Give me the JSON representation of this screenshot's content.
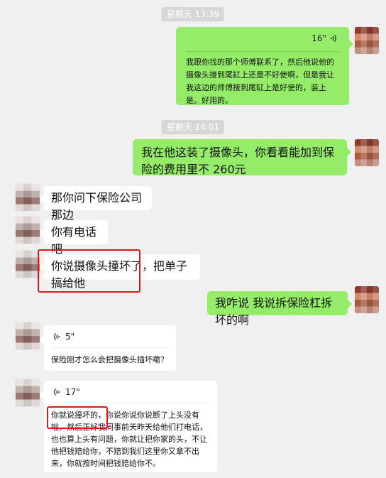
{
  "timestamps": {
    "first": "星期天 13:39",
    "second": "星期天 14:01"
  },
  "messages": {
    "m1": {
      "duration": "16\"",
      "text": "我跟你找的那个师傅联系了，然后他说他的摄像头接到尾缸上还是不好使啊，但是我让我这边的师傅接到尾缸上是好使的，装上是。好用的。"
    },
    "m2": {
      "text": "我在他这装了摄像头，你看看能加到保险的费用里不 260元"
    },
    "m3": {
      "text": "那你问下保险公司那边"
    },
    "m4": {
      "text": "你有电话吧"
    },
    "m5": {
      "text": "你说摄像头撞坏了，把单子搞给他"
    },
    "m6": {
      "text": "我咋说 我说拆保险杠拆坏的啊"
    },
    "m7": {
      "duration": "5\"",
      "text": "保险刚才怎么会把摄像头插坏嘞？"
    },
    "m8": {
      "duration": "17\"",
      "text": "你就说撞坏的，你说你说你说断了上头没有啦，然后正好我同事前天昨天给他们打电话，也也算上头有问题，你就让把你家的头，不让他把钱赔给你，不赔到我们这里你又拿不出来，你就按时间把钱赔给你不。"
    }
  }
}
